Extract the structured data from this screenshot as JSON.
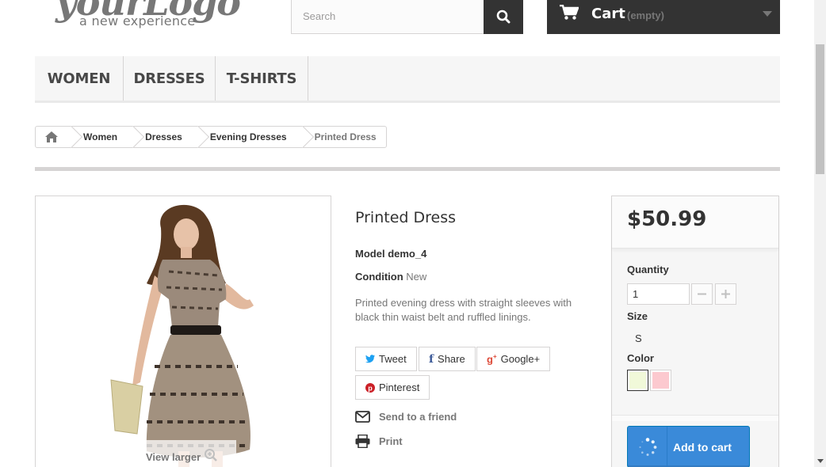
{
  "header": {
    "logo_script": "yourLogo",
    "logo_tagline": "a new experience",
    "search_placeholder": "Search",
    "cart_label": "Cart",
    "cart_status": "(empty)"
  },
  "nav": {
    "items": [
      {
        "label": "WOMEN"
      },
      {
        "label": "DRESSES"
      },
      {
        "label": "T-SHIRTS"
      }
    ]
  },
  "breadcrumb": [
    "Women",
    "Dresses",
    "Evening Dresses",
    "Printed Dress"
  ],
  "product": {
    "view_larger": "View larger",
    "title": "Printed Dress",
    "model_label": "Model",
    "model_value": "demo_4",
    "condition_label": "Condition",
    "condition_value": "New",
    "description": "Printed evening dress with straight sleeves with black thin waist belt and ruffled linings.",
    "share_buttons": [
      "Tweet",
      "Share",
      "Google+",
      "Pinterest"
    ],
    "send_to_friend": "Send to a friend",
    "print": "Print"
  },
  "buy": {
    "price": "$50.99",
    "quantity_label": "Quantity",
    "quantity_value": "1",
    "size_label": "Size",
    "size_value": "S",
    "color_label": "Color",
    "colors": [
      "#f1f9d9",
      "#fcc9cf"
    ],
    "add_to_cart": "Add to cart"
  },
  "colors": {
    "dark": "#333333",
    "primary_button": "#3a8ad9",
    "border": "#d6d4d4"
  }
}
